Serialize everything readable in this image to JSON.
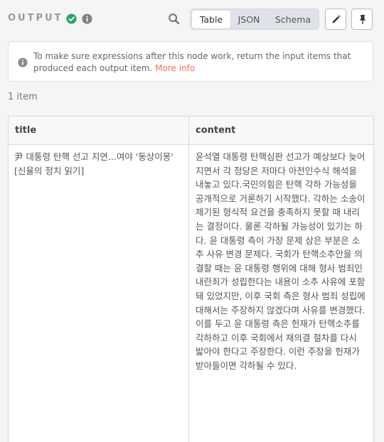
{
  "header": {
    "title": "OUTPUT",
    "icons": [
      "check-circle-icon",
      "info-icon",
      "search-icon",
      "pencil-icon",
      "pin-icon"
    ],
    "tabs": [
      {
        "label": "Table",
        "active": true
      },
      {
        "label": "JSON",
        "active": false
      },
      {
        "label": "Schema",
        "active": false
      }
    ]
  },
  "notice": {
    "text": "To make sure expressions after this node work, return the input items that produced each output item.",
    "link": "More info"
  },
  "item_count": "1 item",
  "table": {
    "columns": [
      "title",
      "content"
    ],
    "rows": [
      {
        "title": "尹 대통령 탄핵 선고 지연...여야 '동상이몽' [신율의 정치 읽기]",
        "content": "윤석열 대통령 탄핵심판 선고가 예상보다 늦어지면서 각 정당은 저마다 아전인수식 해석을 내놓고 있다.국민의힘은 탄핵 각하 가능성을 공개적으로 거론하기 시작했다. 각하는 소송이 제기된 형식적 요건을 충족하지 못할 때 내리는 결정이다. 물론 각하될 가능성이 있기는 하다. 윤 대통령 측이 가장 문제 삼은 부분은 소추 사유 변경 문제다. 국회가 탄핵소추안을 의결할 때는 윤 대통령 행위에 대해 형사 범죄인 내란죄가 성립한다는 내용이 소추 사유에 포함돼 있었지만, 이후 국회 측은 형사 범죄 성립에 대해서는 주장하지 않겠다며 사유를 변경했다. 이를 두고 윤 대통령 측은 헌재가 탄핵소추를 각하하고 이후 국회에서 재의결 절차를 다시 밟아야 한다고 주장한다. 이런 주장을 헌재가 받아들이면 각하될 수 있다."
      }
    ]
  },
  "colors": {
    "success": "#29a36a",
    "link": "#ff6d5a",
    "muted": "#9a9a9a",
    "tabs_bg": "#dfe2e8"
  }
}
